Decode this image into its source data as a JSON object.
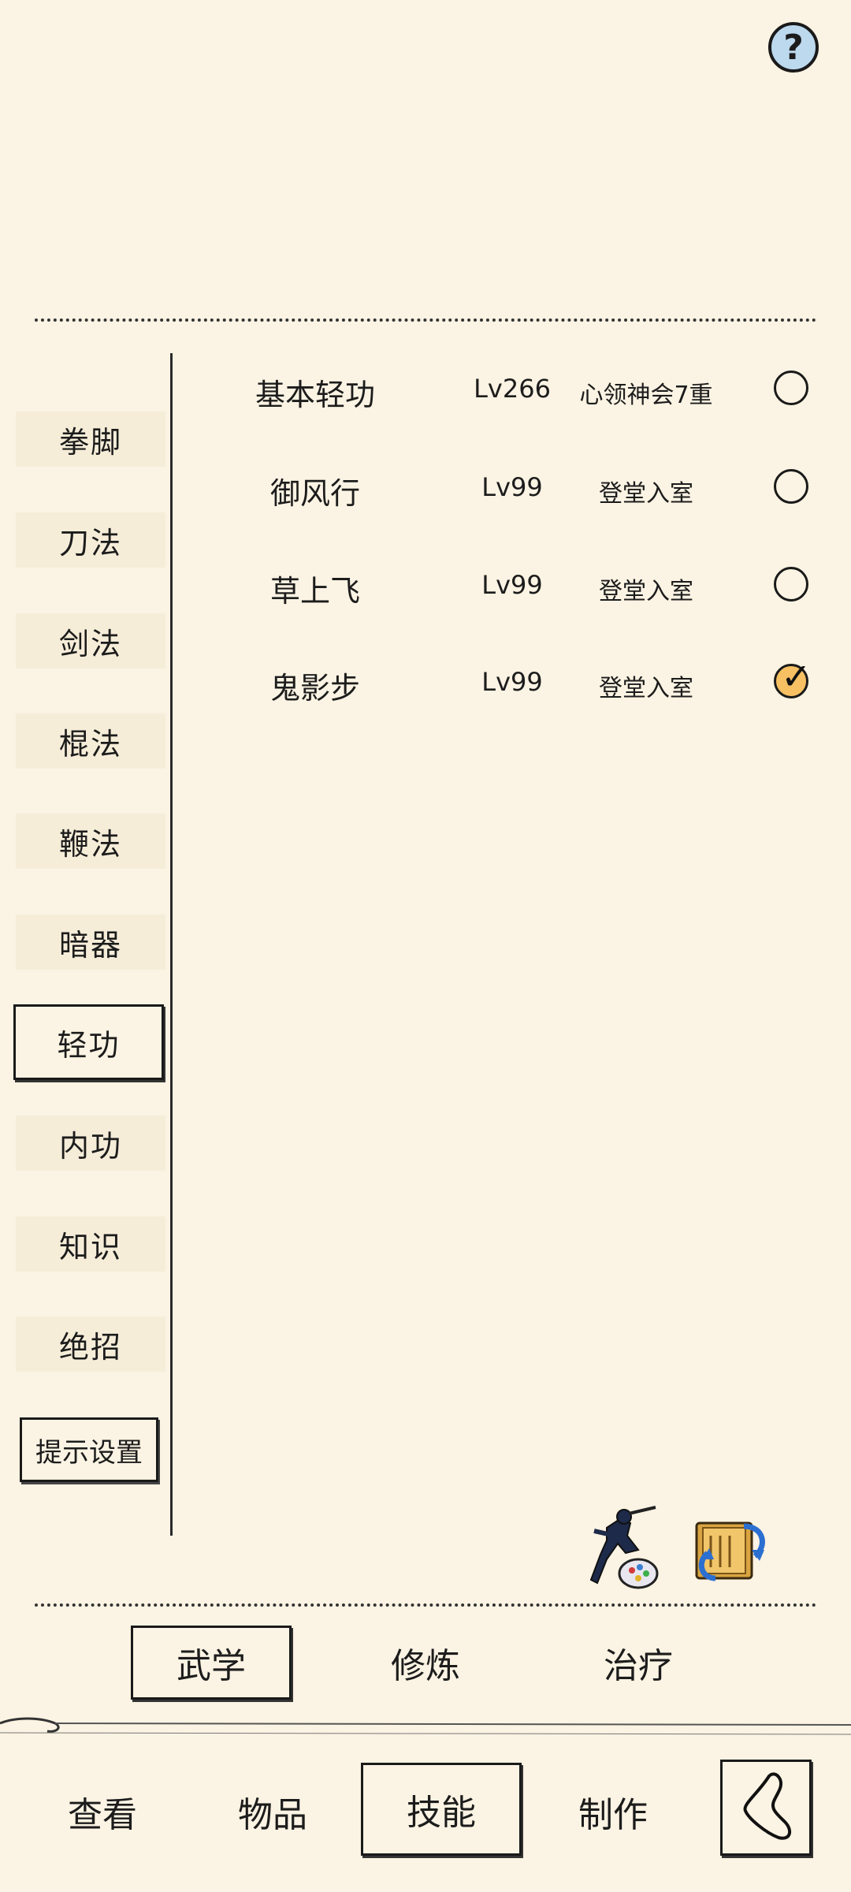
{
  "help": {
    "icon": "question-mark-icon",
    "label": "?"
  },
  "sidebar": {
    "categories": [
      {
        "label": "拳脚"
      },
      {
        "label": "刀法"
      },
      {
        "label": "剑法"
      },
      {
        "label": "棍法"
      },
      {
        "label": "鞭法"
      },
      {
        "label": "暗器"
      },
      {
        "label": "轻功",
        "active": true
      },
      {
        "label": "内功"
      },
      {
        "label": "知识"
      },
      {
        "label": "绝招"
      }
    ],
    "hint_settings": "提示设置"
  },
  "skills": [
    {
      "name": "基本轻功",
      "level": "Lv266",
      "rank": "心领神会7重",
      "checked": false
    },
    {
      "name": "御风行",
      "level": "Lv99",
      "rank": "登堂入室",
      "checked": false
    },
    {
      "name": "草上飞",
      "level": "Lv99",
      "rank": "登堂入室",
      "checked": false
    },
    {
      "name": "鬼影步",
      "level": "Lv99",
      "rank": "登堂入室",
      "checked": true
    }
  ],
  "bottom_icons": [
    "ninja-icon",
    "scroll-swap-icon"
  ],
  "subtabs": [
    {
      "label": "武学",
      "active": true
    },
    {
      "label": "修炼"
    },
    {
      "label": "治疗"
    }
  ],
  "nav": [
    {
      "label": "查看"
    },
    {
      "label": "物品"
    },
    {
      "label": "技能",
      "active": true
    },
    {
      "label": "制作"
    }
  ],
  "colors": {
    "background": "#fbf3e3",
    "help_fill": "#bcd9ee",
    "checked_fill": "#f6c063",
    "ink": "#1c1c1c"
  }
}
